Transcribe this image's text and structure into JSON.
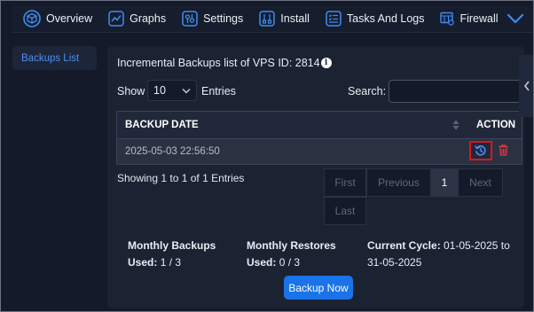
{
  "nav": {
    "items": [
      {
        "label": "Overview",
        "icon": "cube-icon"
      },
      {
        "label": "Graphs",
        "icon": "line-chart-icon"
      },
      {
        "label": "Settings",
        "icon": "settings-sliders-icon"
      },
      {
        "label": "Install",
        "icon": "install-icon"
      },
      {
        "label": "Tasks And Logs",
        "icon": "tasks-list-icon"
      },
      {
        "label": "Firewall",
        "icon": "firewall-icon"
      }
    ],
    "toggle_icon": "chevron-down-icon"
  },
  "sidebar": {
    "items": [
      {
        "label": "Backups List"
      }
    ]
  },
  "card": {
    "title": "Incremental Backups list of VPS ID: 2814",
    "info_icon_glyph": "i"
  },
  "controls": {
    "show_label": "Show",
    "page_size": "10",
    "entries_label": "Entries",
    "search_label": "Search:",
    "search_value": ""
  },
  "table": {
    "headers": {
      "date": "BACKUP DATE",
      "action": "ACTION"
    },
    "rows": [
      {
        "date": "2025-05-03 22:56:50"
      }
    ]
  },
  "showing_text": "Showing 1 to 1 of 1 Entries",
  "pagination": {
    "first": "First",
    "previous": "Previous",
    "current": "1",
    "next": "Next",
    "last": "Last"
  },
  "stats": {
    "monthly_backups_label": "Monthly Backups",
    "used_label": "Used:",
    "monthly_backups_used": "1 / 3",
    "monthly_restores_label": "Monthly Restores",
    "monthly_restores_used": "0 / 3",
    "current_cycle_label": "Current Cycle:",
    "current_cycle_line1": "01-05-2025 to",
    "current_cycle_line2": "31-05-2025"
  },
  "backup_now_label": "Backup Now",
  "colors": {
    "accent": "#1a73e8",
    "highlight": "#e0141b",
    "delete": "#e53945",
    "link": "#4d8ef7"
  }
}
